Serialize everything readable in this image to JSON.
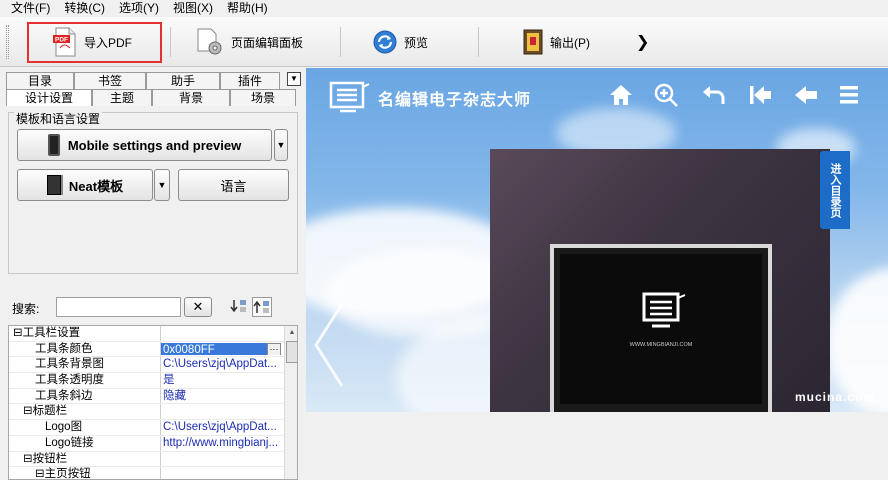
{
  "menubar": {
    "items": [
      "文件(F)",
      "转换(C)",
      "选项(Y)",
      "视图(X)",
      "帮助(H)"
    ]
  },
  "toolbar": {
    "import_pdf": "导入PDF",
    "page_editor": "页面编辑面板",
    "preview": "预览",
    "output": "输出(P)",
    "pdf_badge": "PDF",
    "more": "❯"
  },
  "left_panel": {
    "tabs_row1": [
      "目录",
      "书签",
      "助手",
      "插件"
    ],
    "tabs_row2": [
      "设计设置",
      "主题",
      "背景",
      "场景"
    ],
    "group_title": "模板和语言设置",
    "mobile_button": "Mobile settings and preview",
    "neat_button": "Neat模板",
    "language_button": "语言",
    "search_label": "搜索:",
    "clear_symbol": "✕"
  },
  "properties": [
    {
      "name": "⊟工具栏设置",
      "value": "",
      "level": 0
    },
    {
      "name": "工具条颜色",
      "value": "0x0080FF",
      "level": 2,
      "selected": true
    },
    {
      "name": "工具条背景图",
      "value": "C:\\Users\\zjq\\AppDat...",
      "level": 2
    },
    {
      "name": "工具条透明度",
      "value": "是",
      "level": 2
    },
    {
      "name": "工具条斜边",
      "value": "隐藏",
      "level": 2
    },
    {
      "name": "⊟标题栏",
      "value": "",
      "level": 1
    },
    {
      "name": "Logo图",
      "value": "C:\\Users\\zjq\\AppDat...",
      "level": 3
    },
    {
      "name": "Logo链接",
      "value": "http://www.mingbianj...",
      "level": 3
    },
    {
      "name": "⊟按钮栏",
      "value": "",
      "level": 1
    },
    {
      "name": "⊟主页按钮",
      "value": "",
      "level": 2
    }
  ],
  "preview": {
    "brand": "名编辑电子杂志大师",
    "side_tab": "进入目录页",
    "monitor_site": "WWW.MINGBIANJI.COM",
    "watermark": "mucina.com"
  },
  "colors": {
    "accent": "#3879d9",
    "highlight_box": "#e53030",
    "side_tab": "#1d6cc7",
    "book": "#3e3442"
  }
}
